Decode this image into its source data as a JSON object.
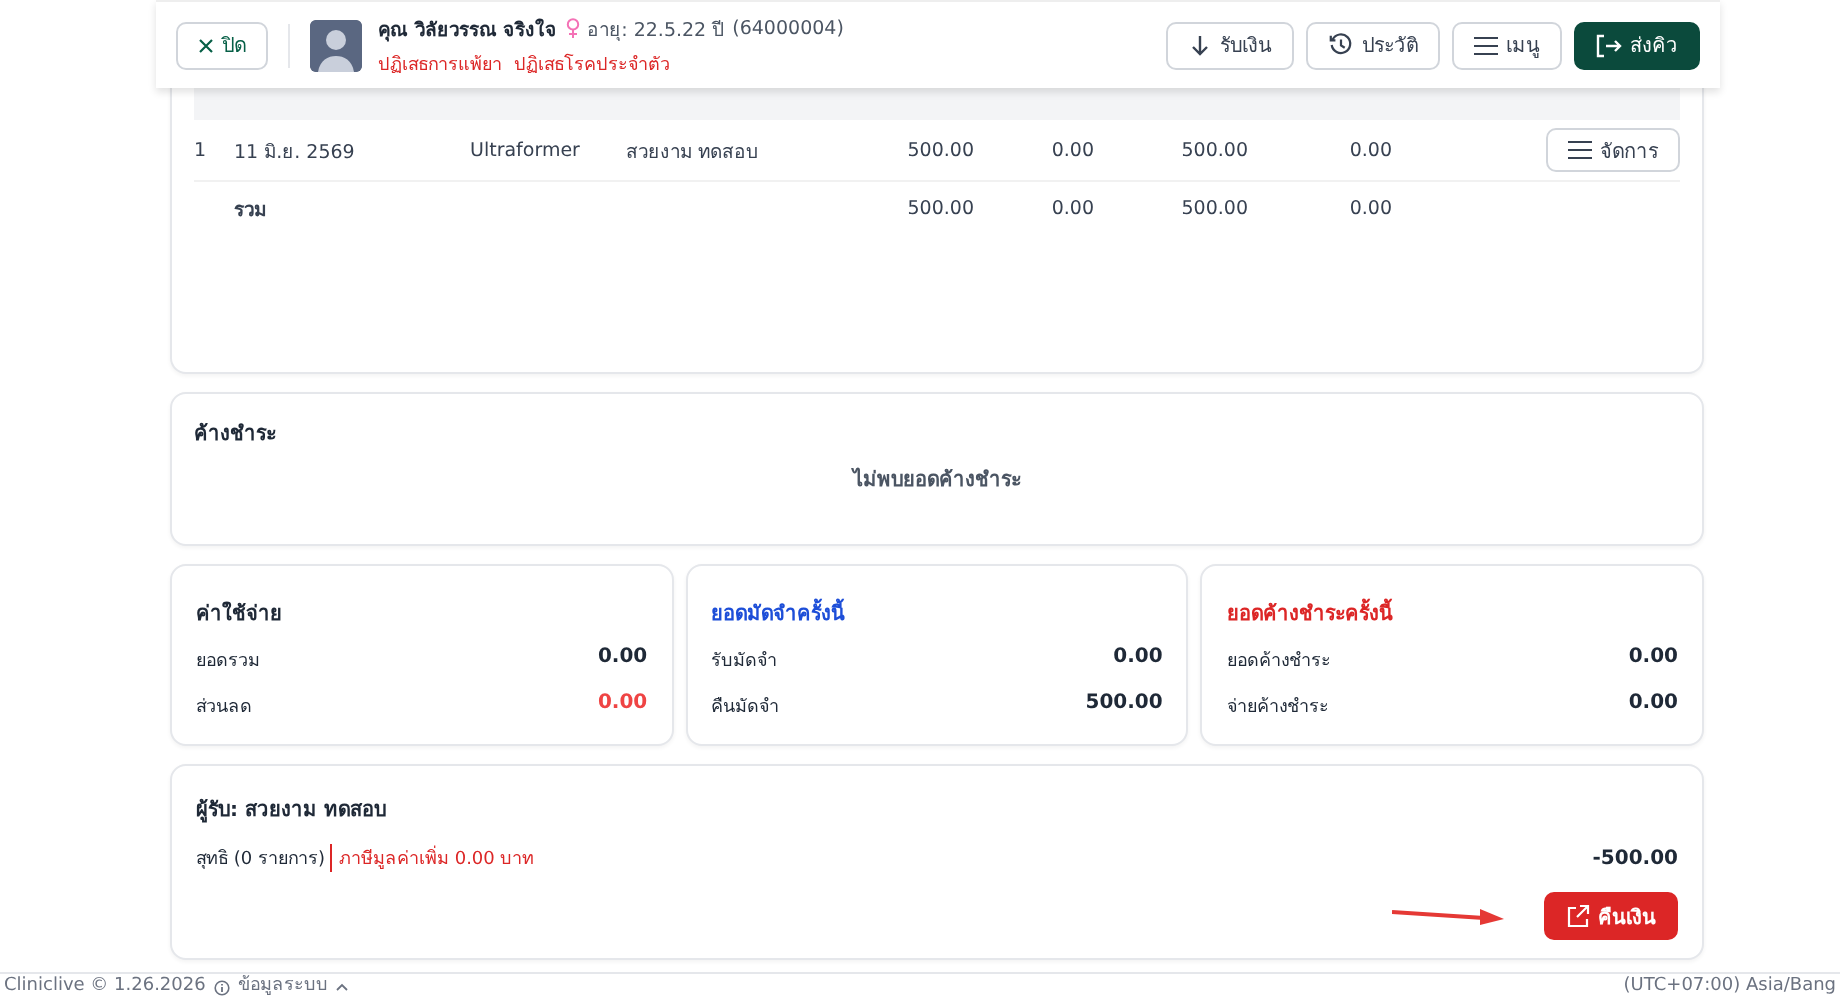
{
  "header": {
    "close_label": "ปิด",
    "patient_name": "คุณ วิลัยวรรณ จริงใจ",
    "age": "อายุ: 22.5.22 ปี",
    "patient_id": "(64000004)",
    "alerts": [
      "ปฏิเสธการแพ้ยา",
      "ปฏิเสธโรคประจำตัว"
    ],
    "buttons": [
      {
        "label": "รับเงิน",
        "kind": "receive"
      },
      {
        "label": "ประวัติ",
        "kind": "history"
      },
      {
        "label": "เมนู",
        "kind": "menu"
      },
      {
        "label": "ส่งคิว",
        "kind": "send"
      }
    ]
  },
  "deposit_table": {
    "rows": [
      {
        "index": "1",
        "date": "11 มิ.ย. 2569",
        "item": "Ultraformer",
        "recipient": "สวยงาม ทดสอบ",
        "amount": "500.00",
        "used": "0.00",
        "refund": "500.00",
        "remaining": "0.00",
        "action": "จัดการ"
      }
    ],
    "total": {
      "label": "รวม",
      "amount": "500.00",
      "used": "0.00",
      "refund": "500.00",
      "remaining": "0.00"
    }
  },
  "outstanding": {
    "title": "ค้างชำระ",
    "empty_message": "ไม่พบยอดค้างชำระ"
  },
  "summary_cards": [
    {
      "title": "ค่าใช้จ่าย",
      "color": "#1f2937",
      "lines": [
        {
          "label": "ยอดรวม",
          "value": "0.00",
          "negative": false
        },
        {
          "label": "ส่วนลด",
          "value": "0.00",
          "negative": true
        }
      ]
    },
    {
      "title": "ยอดมัดจำครั้งนี้",
      "color": "#1d4ed8",
      "lines": [
        {
          "label": "รับมัดจำ",
          "value": "0.00",
          "negative": false
        },
        {
          "label": "คืนมัดจำ",
          "value": "500.00",
          "negative": false
        }
      ]
    },
    {
      "title": "ยอดค้างชำระครั้งนี้",
      "color": "#dc2626",
      "lines": [
        {
          "label": "ยอดค้างชำระ",
          "value": "0.00",
          "negative": false
        },
        {
          "label": "จ่ายค้างชำระ",
          "value": "0.00",
          "negative": false
        }
      ]
    }
  ],
  "payment": {
    "recipient": "ผู้รับ: สวยงาม ทดสอบ",
    "net_label": "สุทธิ (0 รายการ)",
    "vat": "ภาษีมูลค่าเพิ่ม 0.00 บาท",
    "net_value": "-500.00",
    "refund_button": "คืนเงิน"
  },
  "footer": {
    "version": "Cliniclive © 1.26.2026",
    "system_info": "ข้อมูลระบบ",
    "timezone": "(UTC+07:00) Asia/Bang"
  }
}
